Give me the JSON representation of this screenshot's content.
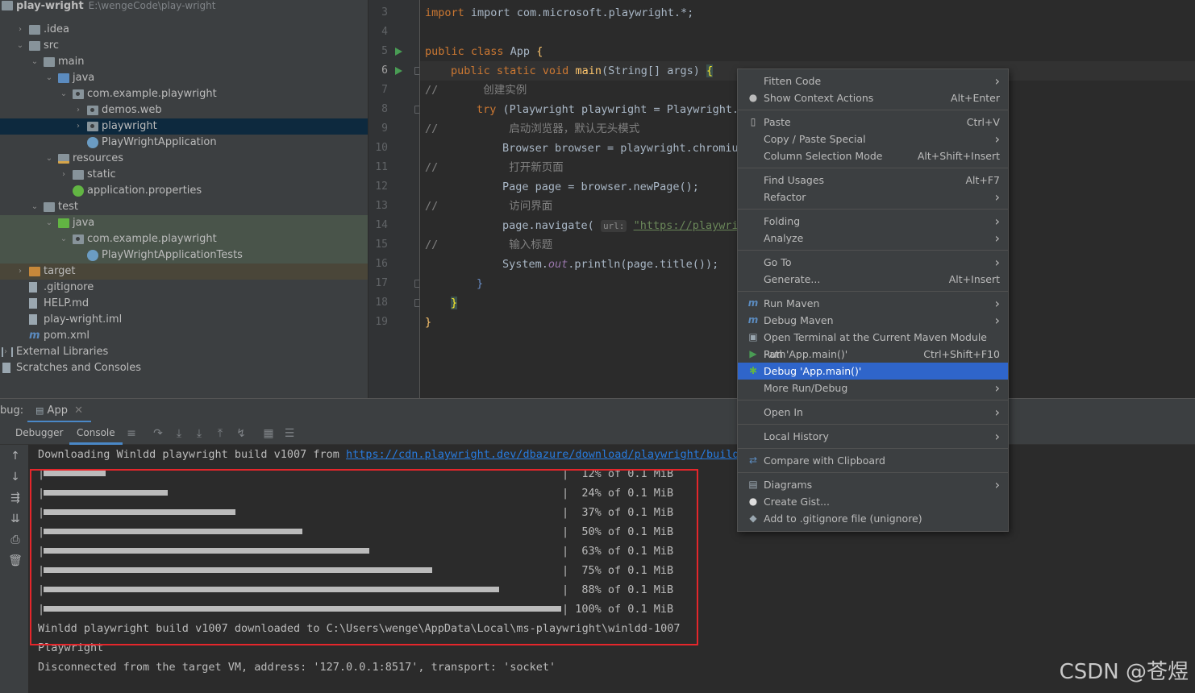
{
  "project": {
    "root_name": "play-wright",
    "root_path": "E:\\wengeCode\\play-wright",
    "items": [
      {
        "label": "play-wright",
        "depth": 0,
        "kind": "root"
      },
      {
        "label": ".idea",
        "depth": 1,
        "kind": "folder",
        "arrow": "right"
      },
      {
        "label": "src",
        "depth": 1,
        "kind": "folder",
        "arrow": "down"
      },
      {
        "label": "main",
        "depth": 2,
        "kind": "folder",
        "arrow": "down"
      },
      {
        "label": "java",
        "depth": 3,
        "kind": "src",
        "arrow": "down"
      },
      {
        "label": "com.example.playwright",
        "depth": 4,
        "kind": "pkg",
        "arrow": "down"
      },
      {
        "label": "demos.web",
        "depth": 5,
        "kind": "pkg",
        "arrow": "right"
      },
      {
        "label": "playwright",
        "depth": 5,
        "kind": "pkg",
        "arrow": "right",
        "selected": true
      },
      {
        "label": "PlayWrightApplication",
        "depth": 5,
        "kind": "spring"
      },
      {
        "label": "resources",
        "depth": 3,
        "kind": "res",
        "arrow": "down"
      },
      {
        "label": "static",
        "depth": 4,
        "kind": "folder",
        "arrow": "right"
      },
      {
        "label": "application.properties",
        "depth": 4,
        "kind": "springgreen"
      },
      {
        "label": "test",
        "depth": 2,
        "kind": "folder",
        "arrow": "down"
      },
      {
        "label": "java",
        "depth": 3,
        "kind": "test",
        "arrow": "down",
        "testbg": true
      },
      {
        "label": "com.example.playwright",
        "depth": 4,
        "kind": "pkg",
        "arrow": "down",
        "testbg": true
      },
      {
        "label": "PlayWrightApplicationTests",
        "depth": 5,
        "kind": "spring",
        "testbg": true
      },
      {
        "label": "target",
        "depth": 1,
        "kind": "target",
        "arrow": "right",
        "targetbg": true
      },
      {
        "label": ".gitignore",
        "depth": 1,
        "kind": "file"
      },
      {
        "label": "HELP.md",
        "depth": 1,
        "kind": "file"
      },
      {
        "label": "play-wright.iml",
        "depth": 1,
        "kind": "file"
      },
      {
        "label": "pom.xml",
        "depth": 1,
        "kind": "maven"
      },
      {
        "label": "External Libraries",
        "depth": 0,
        "kind": "lib",
        "arrow": "right"
      },
      {
        "label": "Scratches and Consoles",
        "depth": 0,
        "kind": "scratch"
      }
    ]
  },
  "editor": {
    "line_numbers": [
      "3",
      "4",
      "5",
      "6",
      "7",
      "8",
      "9",
      "10",
      "11",
      "12",
      "13",
      "14",
      "15",
      "16",
      "17",
      "18",
      "19"
    ],
    "lines": {
      "l3": "import com.microsoft.playwright.*;",
      "l5_kw": "public class ",
      "l5_name": "App ",
      "l5_brace": "{",
      "l6_kw": "public static void ",
      "l6_fn": "main",
      "l6_rest": "(String[] args) ",
      "l6_brace": "{",
      "l7_c": "//",
      "l7_cjk": "创建实例",
      "l8_kw": "try ",
      "l8_rest": "(Playwright playwright = Playwright.c",
      "l9_c": "//",
      "l9_cjk": "启动浏览器，默认无头模式",
      "l10": "Browser browser = playwright.chromium",
      "l11_c": "//",
      "l11_cjk": "打开新页面",
      "l12": "Page page = browser.newPage();",
      "l13_c": "//",
      "l13_cjk": "访问界面",
      "l14_a": "page.navigate(",
      "l14_hint": "url:",
      "l14_str": "\"https://playwright",
      "l15_c": "//",
      "l15_cjk": "输入标题",
      "l16_a": "System.",
      "l16_out": "out",
      "l16_b": ".println(page.title());",
      "l17": "}",
      "l18": "}",
      "l19": "}"
    }
  },
  "debug": {
    "label": "bug:",
    "tab": "App",
    "subtabs": [
      "Debugger",
      "Console"
    ],
    "console_lines": {
      "download": "Downloading Winldd playwright build v1007 from ",
      "download_link": "https://cdn.playwright.dev/dbazure/download/playwright/builds/",
      "progress": [
        {
          "percent": 12,
          "text": "|  12% of 0.1 MiB"
        },
        {
          "percent": 24,
          "text": "|  24% of 0.1 MiB"
        },
        {
          "percent": 37,
          "text": "|  37% of 0.1 MiB"
        },
        {
          "percent": 50,
          "text": "|  50% of 0.1 MiB"
        },
        {
          "percent": 63,
          "text": "|  63% of 0.1 MiB"
        },
        {
          "percent": 75,
          "text": "|  75% of 0.1 MiB"
        },
        {
          "percent": 88,
          "text": "|  88% of 0.1 MiB"
        },
        {
          "percent": 100,
          "text": "| 100% of 0.1 MiB"
        }
      ],
      "downloaded": "Winldd playwright build v1007 downloaded to C:\\Users\\wenge\\AppData\\Local\\ms-playwright\\winldd-1007",
      "title": "Playwright",
      "disconnected": "Disconnected from the target VM, address: '127.0.0.1:8517', transport: 'socket'"
    }
  },
  "context_menu": {
    "items": [
      {
        "label": "Fitten Code",
        "submenu": true
      },
      {
        "label": "Show Context Actions",
        "shortcut": "Alt+Enter",
        "icon": "bulb-icon"
      },
      {
        "label": "Paste",
        "shortcut": "Ctrl+V",
        "icon": "clipboard-icon",
        "sep_before": true
      },
      {
        "label": "Copy / Paste Special",
        "submenu": true
      },
      {
        "label": "Column Selection Mode",
        "shortcut": "Alt+Shift+Insert"
      },
      {
        "label": "Find Usages",
        "shortcut": "Alt+F7",
        "sep_before": true
      },
      {
        "label": "Refactor",
        "submenu": true
      },
      {
        "label": "Folding",
        "submenu": true,
        "sep_before": true
      },
      {
        "label": "Analyze",
        "submenu": true
      },
      {
        "label": "Go To",
        "submenu": true,
        "sep_before": true
      },
      {
        "label": "Generate...",
        "shortcut": "Alt+Insert"
      },
      {
        "label": "Run Maven",
        "submenu": true,
        "icon": "maven-icon",
        "sep_before": true
      },
      {
        "label": "Debug Maven",
        "submenu": true,
        "icon": "maven-icon"
      },
      {
        "label": "Open Terminal at the Current Maven Module Path",
        "icon": "terminal-maven-icon"
      },
      {
        "label": "Run 'App.main()'",
        "shortcut": "Ctrl+Shift+F10",
        "icon": "run-icon"
      },
      {
        "label": "Debug 'App.main()'",
        "icon": "debug-icon",
        "highlighted": true
      },
      {
        "label": "More Run/Debug",
        "submenu": true
      },
      {
        "label": "Open In",
        "submenu": true,
        "sep_before": true
      },
      {
        "label": "Local History",
        "submenu": true,
        "sep_before": true
      },
      {
        "label": "Compare with Clipboard",
        "icon": "compare-icon",
        "sep_before": true
      },
      {
        "label": "Diagrams",
        "submenu": true,
        "icon": "diagram-icon",
        "sep_before": true
      },
      {
        "label": "Create Gist...",
        "icon": "github-icon"
      },
      {
        "label": "Add to .gitignore file (unignore)",
        "icon": "gitignore-icon"
      }
    ]
  },
  "watermark": "CSDN @苍煜"
}
